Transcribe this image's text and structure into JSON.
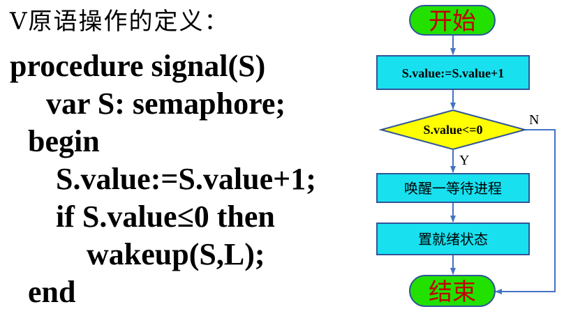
{
  "heading": "V原语操作的定义：",
  "code_lines": [
    "procedure signal(S)",
    "var S: semaphore;",
    "begin",
    "S.value:=S.value+1;",
    "if S.value≤0 then",
    "wakeup(S,L);",
    "end"
  ],
  "flowchart": {
    "start": "开始",
    "step1": "S.value:=S.value+1",
    "decision": "S.value<=0",
    "yes_label": "Y",
    "no_label": "N",
    "step2": "唤醒一等待进程",
    "step3": "置就绪状态",
    "end": "结束"
  },
  "colors": {
    "terminal_fill": "#22e000",
    "terminal_text": "#c00000",
    "process_fill": "#18e0ef",
    "decision_fill": "#ffff00",
    "connector": "#4472c4",
    "border": "#2f5597"
  }
}
